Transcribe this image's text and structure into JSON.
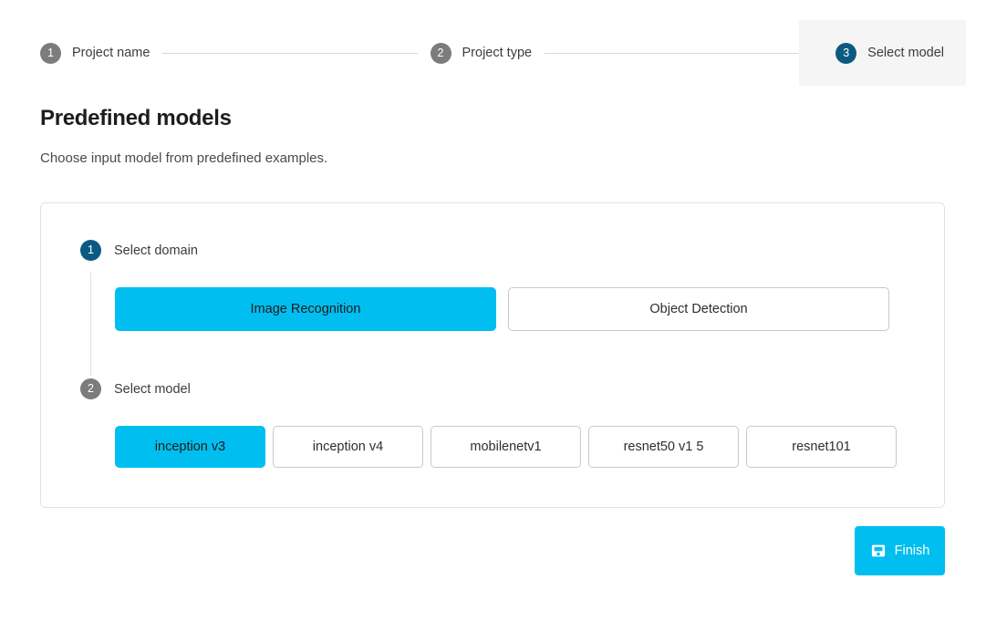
{
  "stepper": {
    "steps": [
      {
        "number": "1",
        "label": "Project name",
        "state": "inactive"
      },
      {
        "number": "2",
        "label": "Project type",
        "state": "inactive"
      },
      {
        "number": "3",
        "label": "Select model",
        "state": "active"
      }
    ]
  },
  "header": {
    "title": "Predefined models",
    "subtitle": "Choose input model from predefined examples."
  },
  "card": {
    "substeps": [
      {
        "number": "1",
        "label": "Select domain",
        "state": "active"
      },
      {
        "number": "2",
        "label": "Select model",
        "state": "inactive"
      }
    ],
    "domains": [
      {
        "label": "Image Recognition",
        "selected": true
      },
      {
        "label": "Object Detection",
        "selected": false
      }
    ],
    "models": [
      {
        "label": "inception v3",
        "selected": true
      },
      {
        "label": "inception v4",
        "selected": false
      },
      {
        "label": "mobilenetv1",
        "selected": false
      },
      {
        "label": "resnet50 v1 5",
        "selected": false
      },
      {
        "label": "resnet101",
        "selected": false
      }
    ]
  },
  "footer": {
    "finish_label": "Finish",
    "finish_icon": "save-icon"
  },
  "colors": {
    "accent_cyan": "#00bff0",
    "step_active_blue": "#0a5a82",
    "step_inactive_gray": "#7c7c7c",
    "active_panel_bg": "#f5f5f5",
    "border_gray": "#c9c9c9"
  }
}
